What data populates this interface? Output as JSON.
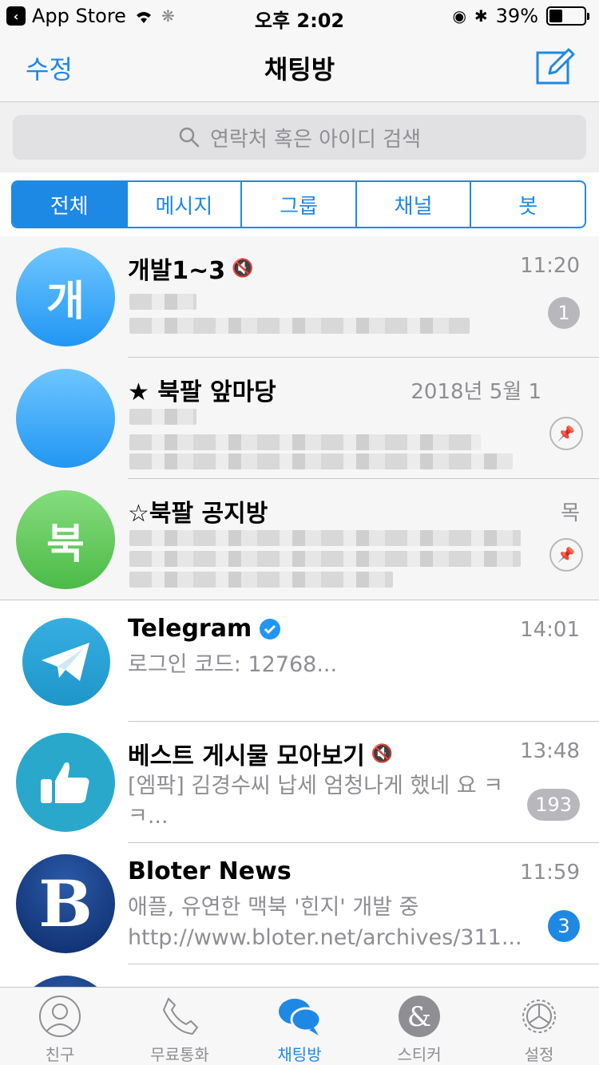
{
  "status": {
    "back_label": "App Store",
    "time": "오후 2:02",
    "battery": "39%",
    "battery_level": 0.39
  },
  "nav": {
    "edit": "수정",
    "title": "채팅방",
    "compose_icon": "compose-icon"
  },
  "search": {
    "placeholder": "연락처 혹은 아이디 검색"
  },
  "segments": [
    "전체",
    "메시지",
    "그룹",
    "채널",
    "봇"
  ],
  "chats": [
    {
      "name": "개발1~3",
      "avatar_text": "개",
      "time": "11:20",
      "muted": true,
      "badge": "1",
      "pinned": false
    },
    {
      "name": "★ 북팔 앞마당",
      "avatar_text": "",
      "time": "2018년 5월 1",
      "pinned": true
    },
    {
      "name": "☆북팔 공지방",
      "avatar_text": "북",
      "time": "목",
      "pinned": true
    },
    {
      "name": "Telegram",
      "time": "14:01",
      "message": "로그인 코드: 12768...",
      "verified": true
    },
    {
      "name": "베스트 게시물 모아보기",
      "time": "13:48",
      "message": "[엠팍] 김경수씨 납세 엄청나게 했네 요 ㅋㅋ...",
      "muted": true,
      "badge": "193"
    },
    {
      "name": "Bloter News",
      "time": "11:59",
      "message": "애플, 유연한 맥북 '힌지' 개발 중 http://www.bloter.net/archives/311...",
      "badge": "3"
    }
  ],
  "tabs": [
    {
      "label": "친구",
      "icon": "person-icon"
    },
    {
      "label": "무료통화",
      "icon": "phone-icon"
    },
    {
      "label": "채팅방",
      "icon": "chat-bubbles-icon",
      "active": true
    },
    {
      "label": "스티커",
      "icon": "sticker-icon"
    },
    {
      "label": "설정",
      "icon": "gear-icon"
    }
  ],
  "colors": {
    "accent": "#1e88e5",
    "badge_gray": "#b8b8bc",
    "separator": "#c8c8cc"
  }
}
